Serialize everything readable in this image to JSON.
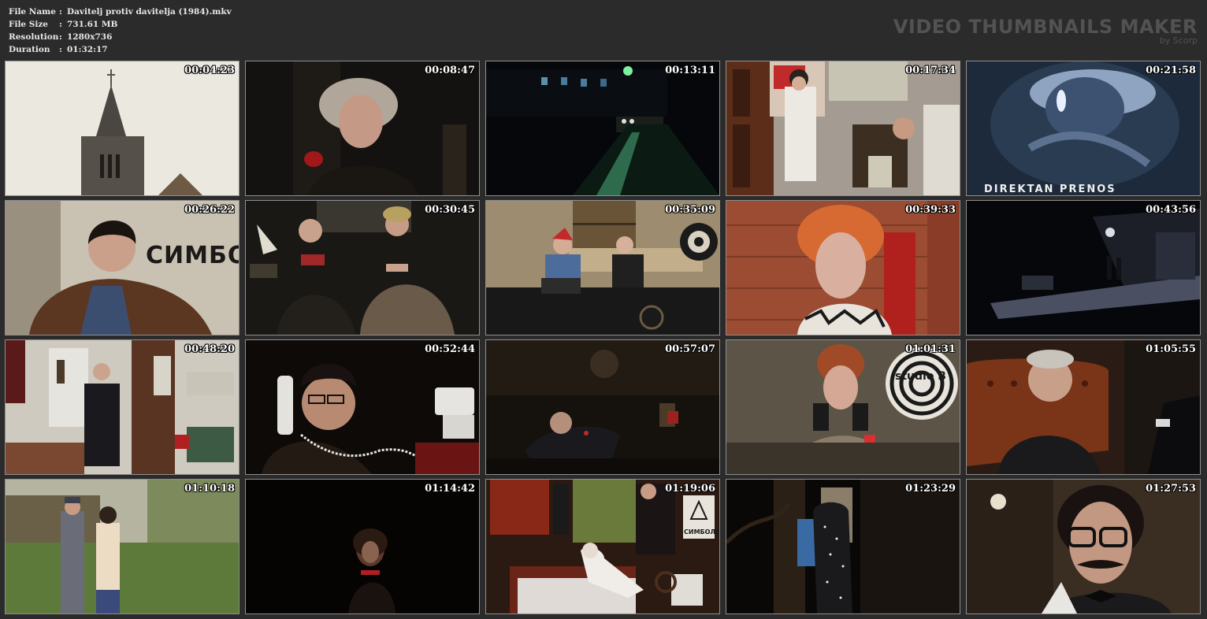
{
  "file_info": {
    "rows": [
      {
        "label": "File Name",
        "value": "Davitelj protiv davitelja (1984).mkv"
      },
      {
        "label": "File Size",
        "value": "731.61 MB"
      },
      {
        "label": "Resolution",
        "value": "1280x736"
      },
      {
        "label": "Duration",
        "value": "01:32:17"
      }
    ],
    "separator": ":"
  },
  "brand": {
    "title": "VIDEO THUMBNAILS MAKER",
    "subtitle": "by Scorp"
  },
  "thumbnails": [
    {
      "timestamp": "00:04:23"
    },
    {
      "timestamp": "00:08:47"
    },
    {
      "timestamp": "00:13:11"
    },
    {
      "timestamp": "00:17:34"
    },
    {
      "timestamp": "00:21:58",
      "overlay_text": "DIREKTAN PRENOS"
    },
    {
      "timestamp": "00:26:22",
      "overlay_text": "СИМБО"
    },
    {
      "timestamp": "00:30:45"
    },
    {
      "timestamp": "00:35:09"
    },
    {
      "timestamp": "00:39:33"
    },
    {
      "timestamp": "00:43:56"
    },
    {
      "timestamp": "00:48:20"
    },
    {
      "timestamp": "00:52:44"
    },
    {
      "timestamp": "00:57:07"
    },
    {
      "timestamp": "01:01:31",
      "overlay_text": "studio B"
    },
    {
      "timestamp": "01:05:55"
    },
    {
      "timestamp": "01:10:18"
    },
    {
      "timestamp": "01:14:42"
    },
    {
      "timestamp": "01:19:06",
      "overlay_text": "СИМБОЛИ"
    },
    {
      "timestamp": "01:23:29"
    },
    {
      "timestamp": "01:27:53"
    }
  ],
  "colors": {
    "background": "#2b2b2b",
    "border": "#8f8f8f",
    "brand": "#525252",
    "text": "#e8e8e8"
  }
}
